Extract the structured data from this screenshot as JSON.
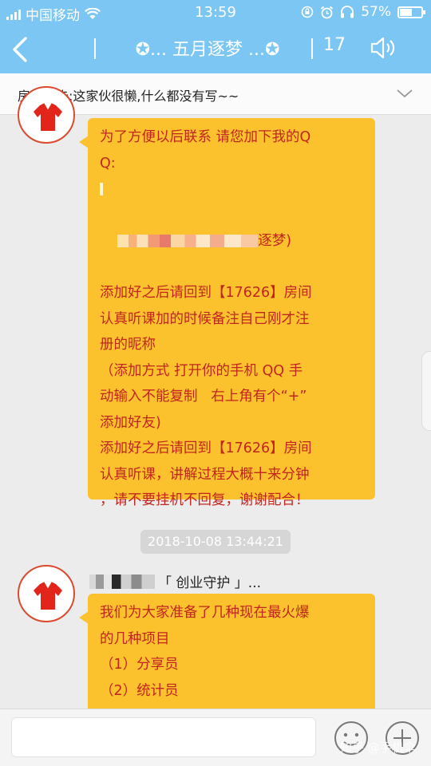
{
  "status": {
    "carrier": "中国移动",
    "time": "13:59",
    "battery": "57%",
    "battery_level": 0.57
  },
  "nav": {
    "title": "✪... 五月逐梦 ...✪",
    "member_count": "17"
  },
  "notice": {
    "text": "房间公告:这家伙很懒,什么都没有写~~"
  },
  "messages": [
    {
      "lines": [
        "为了方便以后联系 请您加下我的Q",
        "Q:",
        "",
        "逐梦)",
        "",
        "添加好之后请回到【17626】房间",
        "认真听课加的时候备注自己刚才注",
        "册的昵称",
        "（添加方式 打开你的手机 QQ 手",
        "动输入不能复制   右上角有个“+”",
        "添加好友)",
        "添加好之后请回到【17626】房间",
        "认真听课，讲解过程大概十来分钟",
        "，请不要挂机不回复，谢谢配合！"
      ]
    },
    {
      "sender": "「 创业守护 」...",
      "lines": [
        "我们为大家准备了几种现在最火爆",
        "的几种项目",
        "（1）分享员",
        "（2）统计员"
      ]
    }
  ],
  "timestamp": "2018-10-08 13:44:21",
  "watermark": "知乎 @手机伞",
  "colors": {
    "nav_bg": "#7cc6f4",
    "bubble_bg": "#fcc22e",
    "bubble_text": "#c2251f",
    "avatar_border": "#d94a2e"
  }
}
